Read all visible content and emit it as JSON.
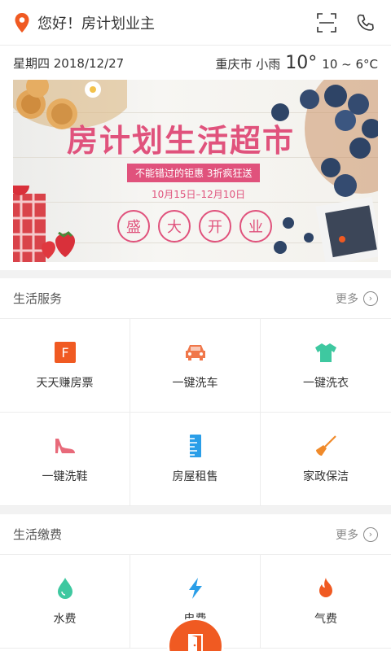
{
  "header": {
    "greeting": "您好！房计划业主",
    "icons": [
      "location-pin-icon",
      "scan-icon",
      "phone-icon"
    ],
    "accent": "#f05a22"
  },
  "info": {
    "date": "星期四 2018/12/27",
    "city_weather": "重庆市 小雨",
    "temp": "10°",
    "temp_range": "10 ~ 6°C"
  },
  "banner": {
    "title": "房计划生活超市",
    "slogan": "不能错过的钜惠  3折疯狂送",
    "dates": "10月15日–12月10日",
    "circles": [
      "盛",
      "大",
      "开",
      "业"
    ],
    "accent": "#e0527c"
  },
  "services": {
    "title": "生活服务",
    "more": "更多",
    "items": [
      {
        "label": "天天赚房票",
        "icon": "f-badge-icon",
        "color": "#f05a22"
      },
      {
        "label": "一键洗车",
        "icon": "car-icon",
        "color": "#f0774a"
      },
      {
        "label": "一键洗衣",
        "icon": "tshirt-icon",
        "color": "#3ec8a0"
      },
      {
        "label": "一键洗鞋",
        "icon": "high-heel-icon",
        "color": "#e86a7a"
      },
      {
        "label": "房屋租售",
        "icon": "ruler-icon",
        "color": "#2a9ee8"
      },
      {
        "label": "家政保洁",
        "icon": "broom-icon",
        "color": "#f08a2a"
      }
    ]
  },
  "payments": {
    "title": "生活缴费",
    "more": "更多",
    "items": [
      {
        "label": "水费",
        "icon": "water-drop-icon",
        "color": "#3ec8a0"
      },
      {
        "label": "电费",
        "icon": "lightning-icon",
        "color": "#2a9ee8"
      },
      {
        "label": "气费",
        "icon": "flame-icon",
        "color": "#f05a22"
      }
    ]
  },
  "fab": {
    "icon": "door-icon",
    "color": "#f05a22"
  }
}
